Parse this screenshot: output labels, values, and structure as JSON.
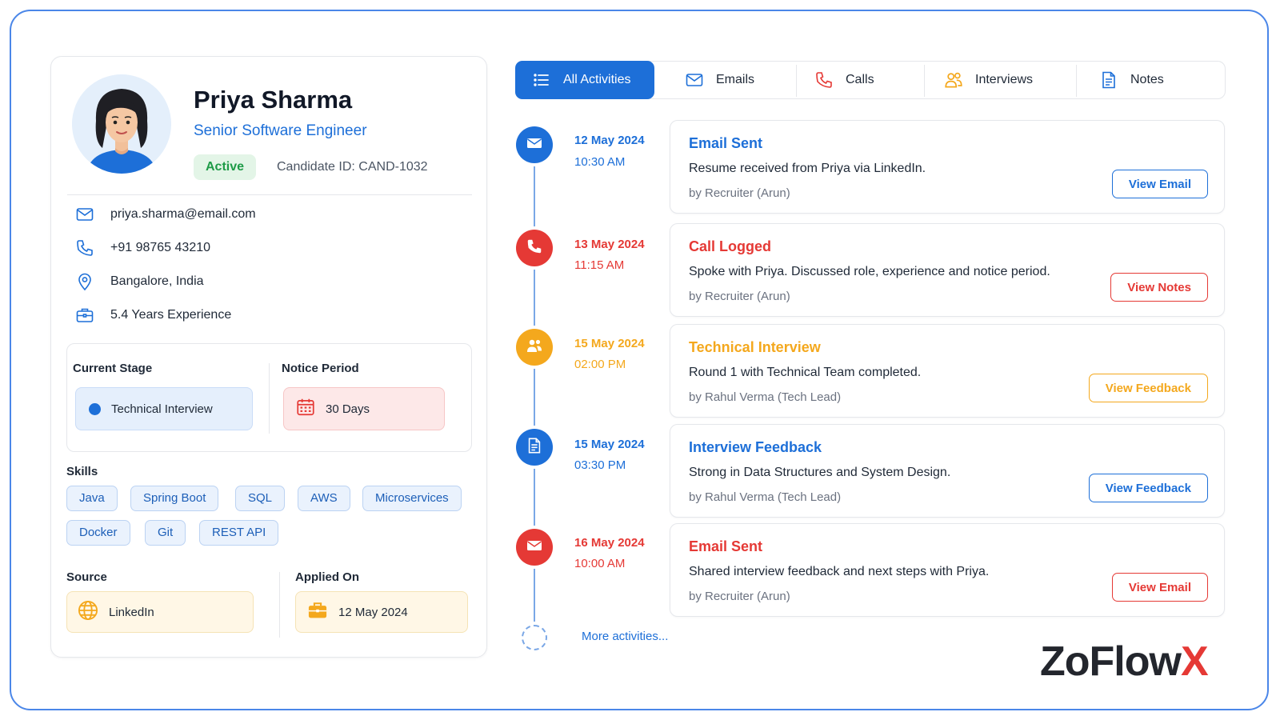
{
  "profile": {
    "name": "Priya Sharma",
    "role": "Senior Software Engineer",
    "status": "Active",
    "candidate_id": "Candidate ID: CAND-1032",
    "contacts": [
      {
        "icon": "mail-icon",
        "text": "priya.sharma@email.com"
      },
      {
        "icon": "phone-icon",
        "text": "+91 98765 43210"
      },
      {
        "icon": "location-icon",
        "text": "Bangalore, India"
      },
      {
        "icon": "briefcase-icon",
        "text": "5.4 Years Experience"
      }
    ],
    "current_stage_label": "Current Stage",
    "current_stage": "Technical Interview",
    "notice_period_label": "Notice Period",
    "notice_period": "30 Days",
    "skills_label": "Skills",
    "skills": [
      "Java",
      "Spring Boot",
      "SQL",
      "AWS",
      "Microservices",
      "Docker",
      "Git",
      "REST API"
    ],
    "source_label": "Source",
    "source": "LinkedIn",
    "applied_label": "Applied On",
    "applied_on": "12 May 2024"
  },
  "tabs": [
    {
      "label": "All Activities",
      "icon": "list-icon",
      "active": true
    },
    {
      "label": "Emails",
      "icon": "mail-icon"
    },
    {
      "label": "Calls",
      "icon": "phone-icon"
    },
    {
      "label": "Interviews",
      "icon": "users-icon"
    },
    {
      "label": "Notes",
      "icon": "document-icon"
    }
  ],
  "activities": [
    {
      "date": "12 May 2024",
      "time": "10:30 AM",
      "title": "Email Sent",
      "desc": "Resume received from Priya via LinkedIn.",
      "by": "by Recruiter (Arun)",
      "button": "View Email",
      "color": "#1d6fd8",
      "icon": "mail-icon"
    },
    {
      "date": "13 May 2024",
      "time": "11:15 AM",
      "title": "Call Logged",
      "desc": "Spoke with Priya. Discussed role, experience and notice period.",
      "by": "by Recruiter (Arun)",
      "button": "View Notes",
      "color": "#e53935",
      "icon": "phone-icon"
    },
    {
      "date": "15 May 2024",
      "time": "02:00 PM",
      "title": "Technical Interview",
      "desc": "Round 1 with Technical Team completed.",
      "by": "by Rahul Verma (Tech Lead)",
      "button": "View Feedback",
      "color": "#f4a81d",
      "icon": "users-icon"
    },
    {
      "date": "15 May 2024",
      "time": "03:30 PM",
      "title": "Interview Feedback",
      "desc": "Strong in Data Structures and System Design.",
      "by": "by Rahul Verma (Tech Lead)",
      "button": "View Feedback",
      "color": "#1d6fd8",
      "icon": "document-icon"
    },
    {
      "date": "16 May 2024",
      "time": "10:00 AM",
      "title": "Email Sent",
      "desc": "Shared interview feedback and next steps with Priya.",
      "by": "by Recruiter (Arun)",
      "button": "View Email",
      "color": "#e53935",
      "icon": "mail-icon"
    }
  ],
  "more_activities": "More activities...",
  "logo": {
    "main": "ZoFlow",
    "accent": "X"
  },
  "colors": {
    "primary": "#1d6fd8",
    "success": "#1e9b47",
    "danger": "#e53935",
    "warning": "#f4a81d"
  }
}
